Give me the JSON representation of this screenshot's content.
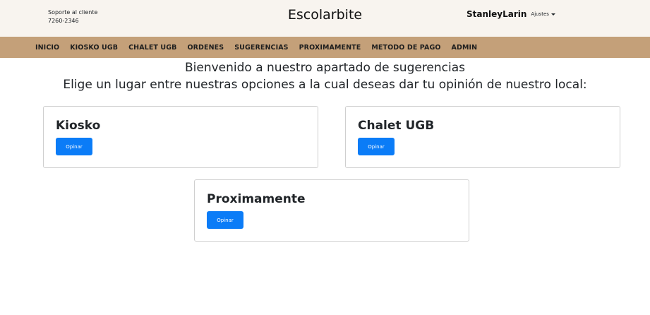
{
  "header": {
    "support_label": "Soporte al cliente",
    "support_phone": "7260-2346",
    "brand": "Escolarbite",
    "username": "StanleyLarin",
    "settings_label": "Ajustes"
  },
  "nav": {
    "items": [
      {
        "label": "INICIO"
      },
      {
        "label": "KIOSKO UGB"
      },
      {
        "label": "CHALET UGB"
      },
      {
        "label": "ORDENES"
      },
      {
        "label": "SUGERENCIAS"
      },
      {
        "label": "PROXIMAMENTE"
      },
      {
        "label": "METODO DE PAGO"
      },
      {
        "label": "ADMIN"
      }
    ]
  },
  "main": {
    "headline_1": "Bienvenido a nuestro apartado de sugerencias",
    "headline_2": "Elige un lugar entre nuestras opciones a la cual deseas dar tu opinión de nuestro local:",
    "cards": [
      {
        "title": "Kiosko",
        "button": "Opinar"
      },
      {
        "title": "Chalet UGB",
        "button": "Opinar"
      },
      {
        "title": "Proximamente",
        "button": "Opinar"
      }
    ]
  },
  "colors": {
    "nav_background": "#c4a079",
    "header_background": "#f8f4ef",
    "button": "#0b7cf7"
  }
}
